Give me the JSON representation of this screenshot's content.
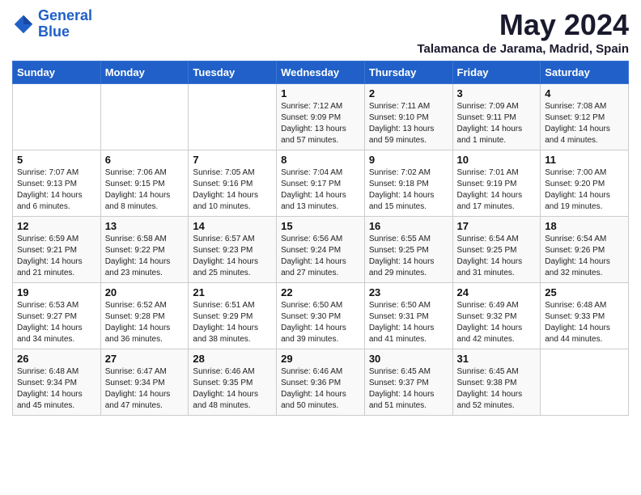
{
  "header": {
    "logo_line1": "General",
    "logo_line2": "Blue",
    "month_title": "May 2024",
    "location": "Talamanca de Jarama, Madrid, Spain"
  },
  "weekdays": [
    "Sunday",
    "Monday",
    "Tuesday",
    "Wednesday",
    "Thursday",
    "Friday",
    "Saturday"
  ],
  "weeks": [
    [
      {
        "day": "",
        "info": ""
      },
      {
        "day": "",
        "info": ""
      },
      {
        "day": "",
        "info": ""
      },
      {
        "day": "1",
        "info": "Sunrise: 7:12 AM\nSunset: 9:09 PM\nDaylight: 13 hours and 57 minutes."
      },
      {
        "day": "2",
        "info": "Sunrise: 7:11 AM\nSunset: 9:10 PM\nDaylight: 13 hours and 59 minutes."
      },
      {
        "day": "3",
        "info": "Sunrise: 7:09 AM\nSunset: 9:11 PM\nDaylight: 14 hours and 1 minute."
      },
      {
        "day": "4",
        "info": "Sunrise: 7:08 AM\nSunset: 9:12 PM\nDaylight: 14 hours and 4 minutes."
      }
    ],
    [
      {
        "day": "5",
        "info": "Sunrise: 7:07 AM\nSunset: 9:13 PM\nDaylight: 14 hours and 6 minutes."
      },
      {
        "day": "6",
        "info": "Sunrise: 7:06 AM\nSunset: 9:15 PM\nDaylight: 14 hours and 8 minutes."
      },
      {
        "day": "7",
        "info": "Sunrise: 7:05 AM\nSunset: 9:16 PM\nDaylight: 14 hours and 10 minutes."
      },
      {
        "day": "8",
        "info": "Sunrise: 7:04 AM\nSunset: 9:17 PM\nDaylight: 14 hours and 13 minutes."
      },
      {
        "day": "9",
        "info": "Sunrise: 7:02 AM\nSunset: 9:18 PM\nDaylight: 14 hours and 15 minutes."
      },
      {
        "day": "10",
        "info": "Sunrise: 7:01 AM\nSunset: 9:19 PM\nDaylight: 14 hours and 17 minutes."
      },
      {
        "day": "11",
        "info": "Sunrise: 7:00 AM\nSunset: 9:20 PM\nDaylight: 14 hours and 19 minutes."
      }
    ],
    [
      {
        "day": "12",
        "info": "Sunrise: 6:59 AM\nSunset: 9:21 PM\nDaylight: 14 hours and 21 minutes."
      },
      {
        "day": "13",
        "info": "Sunrise: 6:58 AM\nSunset: 9:22 PM\nDaylight: 14 hours and 23 minutes."
      },
      {
        "day": "14",
        "info": "Sunrise: 6:57 AM\nSunset: 9:23 PM\nDaylight: 14 hours and 25 minutes."
      },
      {
        "day": "15",
        "info": "Sunrise: 6:56 AM\nSunset: 9:24 PM\nDaylight: 14 hours and 27 minutes."
      },
      {
        "day": "16",
        "info": "Sunrise: 6:55 AM\nSunset: 9:25 PM\nDaylight: 14 hours and 29 minutes."
      },
      {
        "day": "17",
        "info": "Sunrise: 6:54 AM\nSunset: 9:25 PM\nDaylight: 14 hours and 31 minutes."
      },
      {
        "day": "18",
        "info": "Sunrise: 6:54 AM\nSunset: 9:26 PM\nDaylight: 14 hours and 32 minutes."
      }
    ],
    [
      {
        "day": "19",
        "info": "Sunrise: 6:53 AM\nSunset: 9:27 PM\nDaylight: 14 hours and 34 minutes."
      },
      {
        "day": "20",
        "info": "Sunrise: 6:52 AM\nSunset: 9:28 PM\nDaylight: 14 hours and 36 minutes."
      },
      {
        "day": "21",
        "info": "Sunrise: 6:51 AM\nSunset: 9:29 PM\nDaylight: 14 hours and 38 minutes."
      },
      {
        "day": "22",
        "info": "Sunrise: 6:50 AM\nSunset: 9:30 PM\nDaylight: 14 hours and 39 minutes."
      },
      {
        "day": "23",
        "info": "Sunrise: 6:50 AM\nSunset: 9:31 PM\nDaylight: 14 hours and 41 minutes."
      },
      {
        "day": "24",
        "info": "Sunrise: 6:49 AM\nSunset: 9:32 PM\nDaylight: 14 hours and 42 minutes."
      },
      {
        "day": "25",
        "info": "Sunrise: 6:48 AM\nSunset: 9:33 PM\nDaylight: 14 hours and 44 minutes."
      }
    ],
    [
      {
        "day": "26",
        "info": "Sunrise: 6:48 AM\nSunset: 9:34 PM\nDaylight: 14 hours and 45 minutes."
      },
      {
        "day": "27",
        "info": "Sunrise: 6:47 AM\nSunset: 9:34 PM\nDaylight: 14 hours and 47 minutes."
      },
      {
        "day": "28",
        "info": "Sunrise: 6:46 AM\nSunset: 9:35 PM\nDaylight: 14 hours and 48 minutes."
      },
      {
        "day": "29",
        "info": "Sunrise: 6:46 AM\nSunset: 9:36 PM\nDaylight: 14 hours and 50 minutes."
      },
      {
        "day": "30",
        "info": "Sunrise: 6:45 AM\nSunset: 9:37 PM\nDaylight: 14 hours and 51 minutes."
      },
      {
        "day": "31",
        "info": "Sunrise: 6:45 AM\nSunset: 9:38 PM\nDaylight: 14 hours and 52 minutes."
      },
      {
        "day": "",
        "info": ""
      }
    ]
  ]
}
